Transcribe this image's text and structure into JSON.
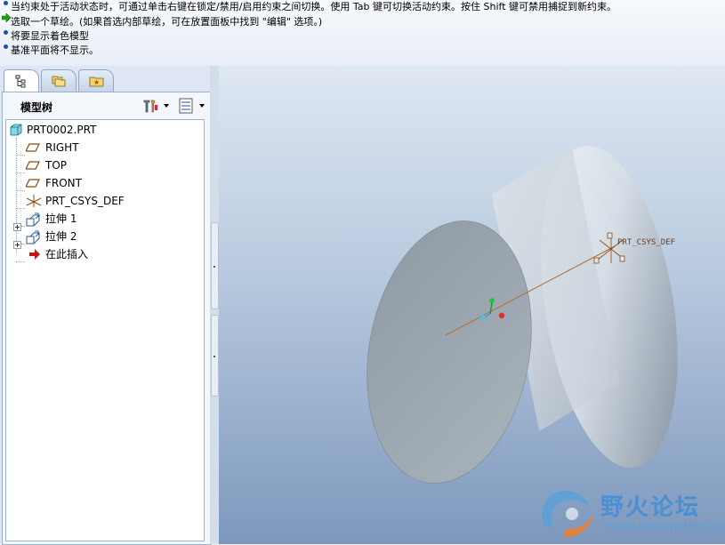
{
  "messages": [
    {
      "icon": "info-bullet-icon",
      "text": "当约束处于活动状态时，可通过单击右键在锁定/禁用/启用约束之间切换。使用 Tab 键可切换活动约束。按住 Shift 键可禁用捕捉到新约束。"
    },
    {
      "icon": "prompt-arrow-icon",
      "text": "选取一个草绘。(如果首选内部草绘，可在放置面板中找到 \"编辑\" 选项。)"
    },
    {
      "icon": "info-bullet-icon",
      "text": "将要显示着色模型"
    },
    {
      "icon": "info-bullet-icon",
      "text": "基准平面将不显示。"
    }
  ],
  "tabs": [
    {
      "name": "model-tree-tab",
      "icon": "tree-icon",
      "active": true
    },
    {
      "name": "folder-browser-tab",
      "icon": "folders-icon",
      "active": false
    },
    {
      "name": "favorites-tab",
      "icon": "star-folder-icon",
      "active": false
    }
  ],
  "model_tree": {
    "title": "模型树",
    "settings_icon": "tools-icon",
    "show_icon": "list-icon",
    "items": [
      {
        "label": "PRT0002.PRT",
        "icon": "part-icon"
      },
      {
        "label": "RIGHT",
        "icon": "datum-plane-icon"
      },
      {
        "label": "TOP",
        "icon": "datum-plane-icon"
      },
      {
        "label": "FRONT",
        "icon": "datum-plane-icon"
      },
      {
        "label": "PRT_CSYS_DEF",
        "icon": "csys-icon"
      },
      {
        "label": "拉伸 1",
        "icon": "extrude-icon"
      },
      {
        "label": "拉伸 2",
        "icon": "extrude-icon"
      },
      {
        "label": "在此插入",
        "icon": "insert-arrow-icon"
      }
    ]
  },
  "graphics": {
    "csys_label": "PRT_CSYS_DEF",
    "background_top": "#dfe8f3",
    "background_bottom": "#7d98bd"
  },
  "watermark": {
    "title": "野火论坛",
    "url": "www.proewildfire.cn"
  },
  "colors": {
    "accent": "#1b4fb0",
    "prompt_arrow": "#1aa01a",
    "insert_arrow": "#cc1111"
  }
}
